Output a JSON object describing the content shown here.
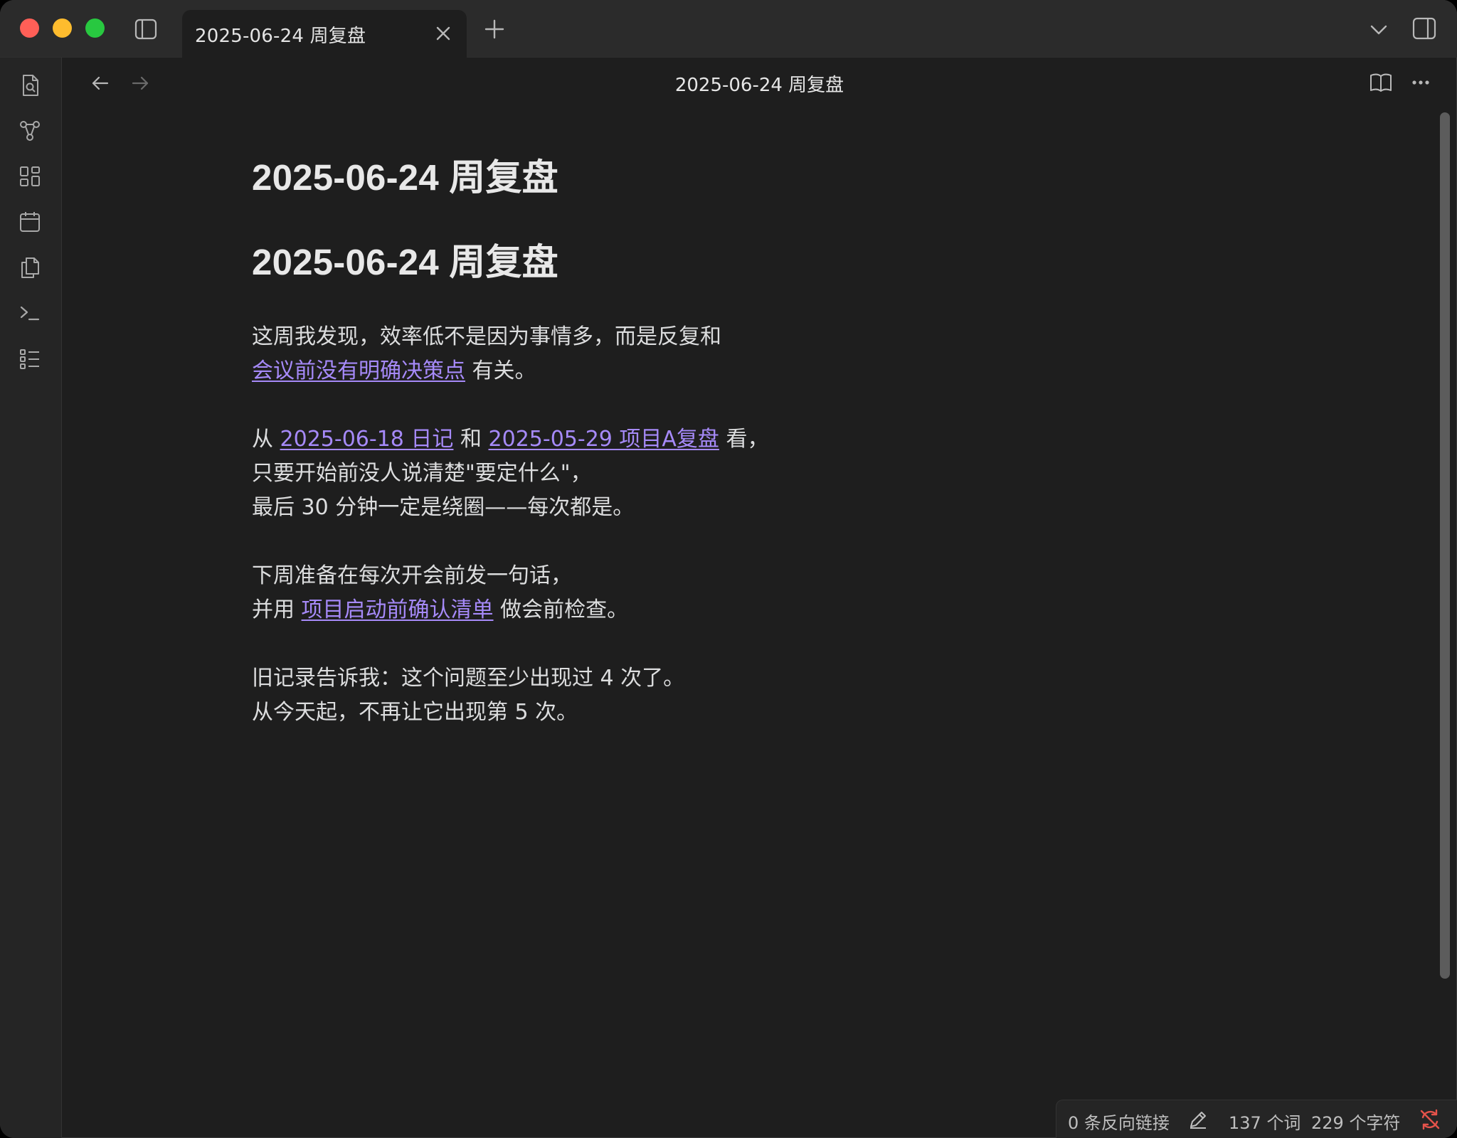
{
  "tab": {
    "title": "2025-06-24 周复盘"
  },
  "view": {
    "title": "2025-06-24 周复盘"
  },
  "document": {
    "inline_title": "2025-06-24 周复盘",
    "heading": "2025-06-24 周复盘",
    "p1": {
      "line1": "这周我发现，效率低不是因为事情多，而是反复和",
      "link1": "会议前没有明确决策点",
      "after1": " 有关。"
    },
    "p2": {
      "pre": "从 ",
      "link1": "2025-06-18 日记",
      "mid": " 和 ",
      "link2": "2025-05-29 项目A复盘",
      "post": " 看，",
      "line2": "只要开始前没人说清楚\"要定什么\"，",
      "line3": "最后 30 分钟一定是绕圈——每次都是。"
    },
    "p3": {
      "line1": "下周准备在每次开会前发一句话，",
      "pre": "并用 ",
      "link1": "项目启动前确认清单",
      "post": " 做会前检查。"
    },
    "p4": {
      "line1": "旧记录告诉我：这个问题至少出现过 4 次了。",
      "line2": "从今天起，不再让它出现第 5 次。"
    }
  },
  "status_bar": {
    "backlinks": "0 条反向链接",
    "words": "137 个词",
    "chars": "229 个字符"
  },
  "icons": {
    "ribbon": [
      "search-file-icon",
      "graph-icon",
      "canvas-icon",
      "calendar-icon",
      "copy-icon",
      "terminal-icon",
      "outline-icon"
    ]
  },
  "colors": {
    "link": "#a68af9",
    "background": "#1e1e1e",
    "sync_error": "#e5534b"
  }
}
